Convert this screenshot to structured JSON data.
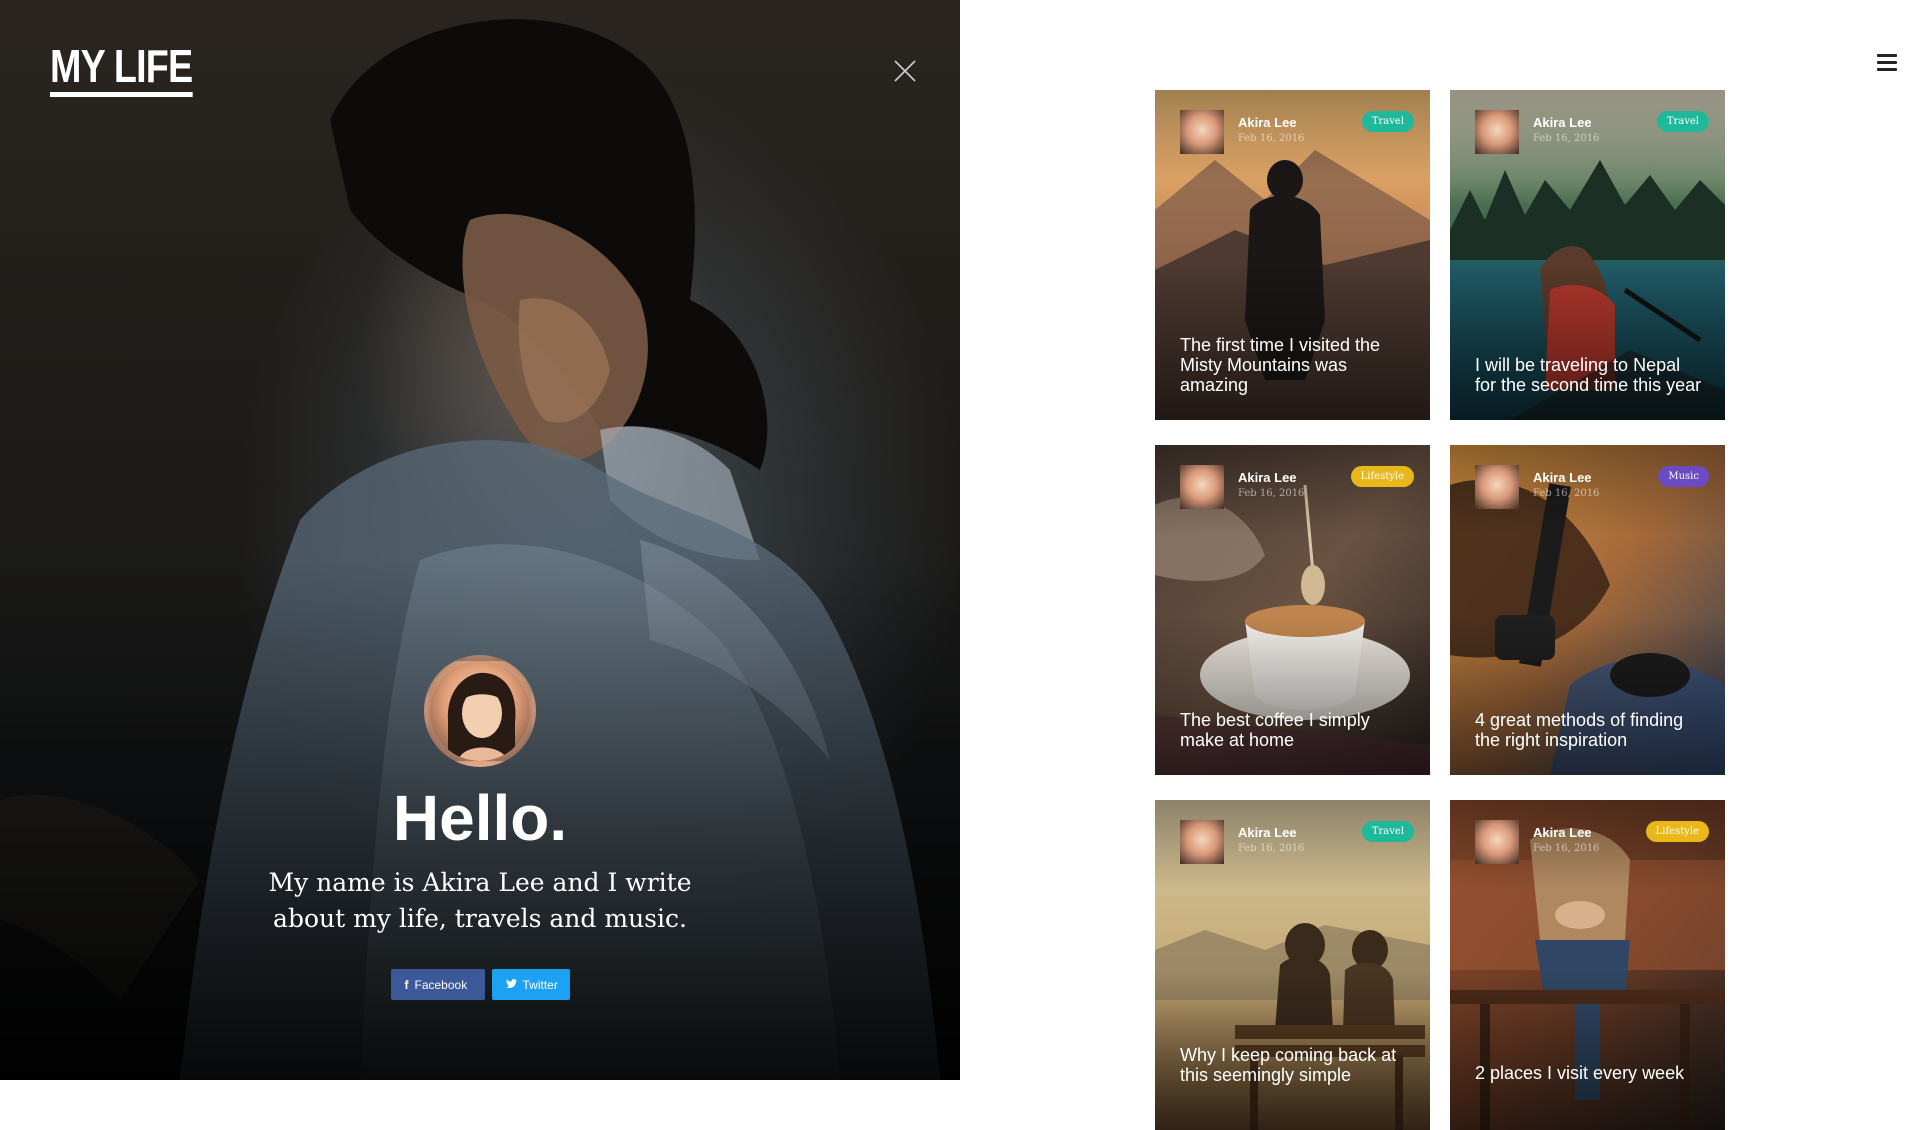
{
  "brand": {
    "logo": "MY LIFE"
  },
  "intro": {
    "title": "Hello.",
    "text": "My name is Akira Lee and I write about my life, travels and music.",
    "facebook_label": "Facebook",
    "twitter_label": "Twitter",
    "facebook_color": "#3b5998",
    "twitter_color": "#1da1f2"
  },
  "icons": {
    "close": "close-icon",
    "menu": "hamburger-menu-icon",
    "facebook": "facebook-icon",
    "twitter": "twitter-icon"
  },
  "posts": [
    {
      "author": "Akira Lee",
      "date": "Feb 16, 2016",
      "category": "Travel",
      "title": "The first time I visited the Misty Mountains was amazing"
    },
    {
      "author": "Akira Lee",
      "date": "Feb 16, 2016",
      "category": "Travel",
      "title": "I will be traveling to Nepal for the second time this year"
    },
    {
      "author": "Akira Lee",
      "date": "Feb 16, 2016",
      "category": "Lifestyle",
      "title": "The best coffee I simply make at home"
    },
    {
      "author": "Akira Lee",
      "date": "Feb 16, 2016",
      "category": "Music",
      "title": "4 great methods of finding the right inspiration"
    },
    {
      "author": "Akira Lee",
      "date": "Feb 16, 2016",
      "category": "Travel",
      "title": "Why I keep coming back at this seemingly simple"
    },
    {
      "author": "Akira Lee",
      "date": "Feb 16, 2016",
      "category": "Lifestyle",
      "title": "2 places I visit every week"
    }
  ],
  "category_colors": {
    "Travel": "#1fb89a",
    "Lifestyle": "#e8b71a",
    "Music": "#6a4bc4"
  }
}
